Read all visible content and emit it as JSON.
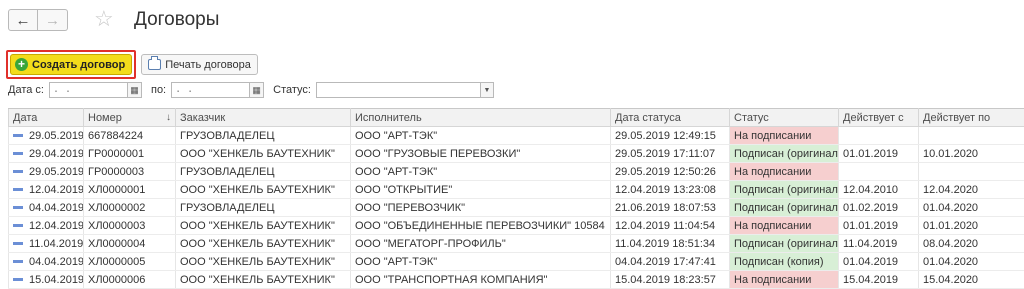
{
  "header": {
    "title": "Договоры",
    "back_icon": "←",
    "forward_icon": "→",
    "star_icon": "☆"
  },
  "toolbar": {
    "create_label": "Создать договор",
    "print_label": "Печать договора"
  },
  "filters": {
    "date_from_label": "Дата с:",
    "date_from_value": ". .",
    "date_to_label": "по:",
    "date_to_value": ". .",
    "status_label": "Статус:",
    "status_value": ""
  },
  "colors": {
    "create_button": "#f3dc1b",
    "highlight_frame": "#e0302b",
    "status_pending": "#f6cfcf",
    "status_signed": "#d8efd6",
    "row_icon": "#6b8fd6"
  },
  "table": {
    "columns": [
      "Дата",
      "Номер",
      "Заказчик",
      "Исполнитель",
      "Дата статуса",
      "Статус",
      "Действует с",
      "Действует по"
    ],
    "sorted_column": "Номер",
    "sort_arrow": "↓",
    "rows": [
      {
        "date": "29.05.2019",
        "number": "667884224",
        "customer": "ГРУЗОВЛАДЕЛЕЦ",
        "contractor": "ООО \"АРТ-ТЭК\"",
        "status_date": "29.05.2019 12:49:15",
        "status": "На подписании",
        "status_kind": "pending",
        "valid_from": "",
        "valid_to": ""
      },
      {
        "date": "29.04.2019",
        "number": "ГР0000001",
        "customer": "ООО \"ХЕНКЕЛЬ БАУТЕХНИК\"",
        "contractor": "ООО \"ГРУЗОВЫЕ ПЕРЕВОЗКИ\"",
        "status_date": "29.05.2019 17:11:07",
        "status": "Подписан (оригинал)",
        "status_kind": "signed",
        "valid_from": "01.01.2019",
        "valid_to": "10.01.2020"
      },
      {
        "date": "29.05.2019",
        "number": "ГР0000003",
        "customer": "ГРУЗОВЛАДЕЛЕЦ",
        "contractor": "ООО \"АРТ-ТЭК\"",
        "status_date": "29.05.2019 12:50:26",
        "status": "На подписании",
        "status_kind": "pending",
        "valid_from": "",
        "valid_to": ""
      },
      {
        "date": "12.04.2019",
        "number": "ХЛ0000001",
        "customer": "ООО \"ХЕНКЕЛЬ БАУТЕХНИК\"",
        "contractor": "ООО \"ОТКРЫТИЕ\"",
        "status_date": "12.04.2019 13:23:08",
        "status": "Подписан (оригинал)",
        "status_kind": "signed",
        "valid_from": "12.04.2010",
        "valid_to": "12.04.2020"
      },
      {
        "date": "04.04.2019",
        "number": "ХЛ0000002",
        "customer": "ГРУЗОВЛАДЕЛЕЦ",
        "contractor": "ООО \"ПЕРЕВОЗЧИК\"",
        "status_date": "21.06.2019 18:07:53",
        "status": "Подписан (оригинал)",
        "status_kind": "signed",
        "valid_from": "01.02.2019",
        "valid_to": "01.04.2020"
      },
      {
        "date": "12.04.2019",
        "number": "ХЛ0000003",
        "customer": "ООО \"ХЕНКЕЛЬ БАУТЕХНИК\"",
        "contractor": "ООО \"ОБЪЕДИНЕННЫЕ ПЕРЕВОЗЧИКИ\" 10584",
        "status_date": "12.04.2019 11:04:54",
        "status": "На подписании",
        "status_kind": "pending",
        "valid_from": "01.01.2019",
        "valid_to": "01.01.2020"
      },
      {
        "date": "11.04.2019",
        "number": "ХЛ0000004",
        "customer": "ООО \"ХЕНКЕЛЬ БАУТЕХНИК\"",
        "contractor": "ООО \"МЕГАТОРГ-ПРОФИЛЬ\"",
        "status_date": "11.04.2019 18:51:34",
        "status": "Подписан (оригинал)",
        "status_kind": "signed",
        "valid_from": "11.04.2019",
        "valid_to": "08.04.2020"
      },
      {
        "date": "04.04.2019",
        "number": "ХЛ0000005",
        "customer": "ООО \"ХЕНКЕЛЬ БАУТЕХНИК\"",
        "contractor": "ООО \"АРТ-ТЭК\"",
        "status_date": "04.04.2019 17:47:41",
        "status": "Подписан (копия)",
        "status_kind": "signed",
        "valid_from": "01.04.2019",
        "valid_to": "01.04.2020"
      },
      {
        "date": "15.04.2019",
        "number": "ХЛ0000006",
        "customer": "ООО \"ХЕНКЕЛЬ БАУТЕХНИК\"",
        "contractor": "ООО \"ТРАНСПОРТНАЯ КОМПАНИЯ\"",
        "status_date": "15.04.2019 18:23:57",
        "status": "На подписании",
        "status_kind": "pending",
        "valid_from": "15.04.2019",
        "valid_to": "15.04.2020"
      }
    ]
  }
}
